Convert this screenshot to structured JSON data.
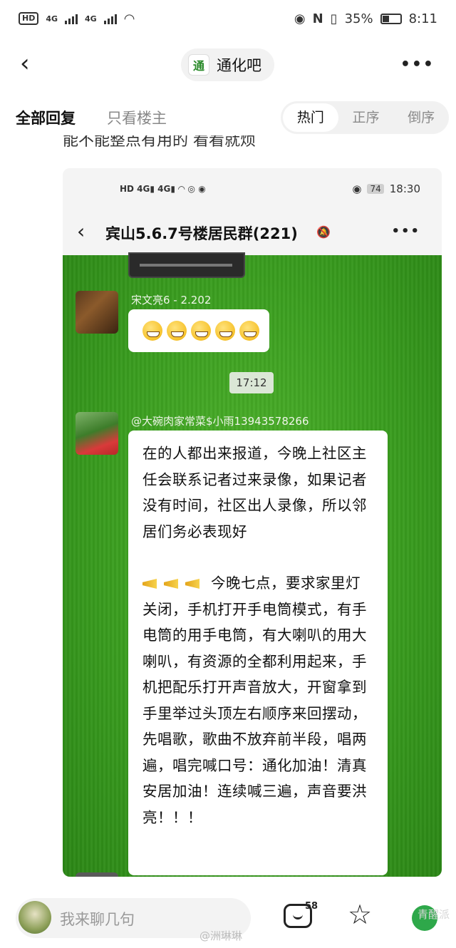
{
  "status_bar": {
    "hd": "HD",
    "sim1": "4G",
    "sim2": "4G",
    "battery_pct": "35%",
    "time": "8:11"
  },
  "header": {
    "back_icon": "chevron-left-icon",
    "forum_name": "通化吧",
    "more_icon": "more-dots-icon"
  },
  "tabs": {
    "all_replies": "全部回复",
    "op_only": "只看楼主",
    "sort": [
      "热门",
      "正序",
      "倒序"
    ],
    "active_sort": "热门"
  },
  "post": {
    "cut_text": "能不能整点有用的 看看就烦"
  },
  "screenshot": {
    "status_time": "18:30",
    "battery": "74",
    "group_title": "宾山5.6.7号楼居民群(221)",
    "msg1_sender": "宋文亮6 - 2.202",
    "time_badge": "17:12",
    "msg2_sender": "@大碗肉家常菜$小雨13943578266",
    "msg2_para1": "在的人都出来报道，今晚上社区主任会联系记者过来录像，如果记者没有时间，社区出人录像，所以邻居们务必表现好",
    "msg2_para2_lead": "今晚七点，要求家",
    "msg2_para2_rest": "里灯关闭，手机打开手电筒模式，有手电筒的用手电筒，有大喇叭的用大喇叭，有资源的全都利用起来，手机把配乐打开声音放大，开窗拿到手里举过头顶左右顺序来回摆动，先唱歌，歌曲不放弃前半段，唱两遍，唱完喊口号：通化加油！清真安居加油！连续喊三遍，声音要洪亮！！！"
  },
  "bottom_bar": {
    "input_placeholder": "我来聊几句",
    "reply_count": "58",
    "watermark_1": "@洲琳琳",
    "watermark_2": "青醒派"
  },
  "colors": {
    "grass": "#3a9d1f",
    "bubble": "#ffffff",
    "share": "#2ea84a"
  }
}
